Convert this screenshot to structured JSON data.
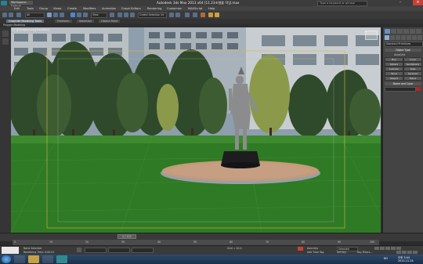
{
  "window": {
    "title": "Autodesk 3ds Max  2013 x64      [11.23조형물 작업.max",
    "workspace": "Workspace: Default",
    "search_placeholder": "Type a keyword or phrase"
  },
  "menus": [
    "Edit",
    "Tools",
    "Group",
    "Views",
    "Create",
    "Modifiers",
    "Animation",
    "Graph Editors",
    "Rendering",
    "Customize",
    "MAXScript",
    "Help"
  ],
  "toolbar": {
    "selection_filter": "All",
    "ref_coord": "View",
    "named_selection": "Create Selection Se"
  },
  "ribbon": {
    "tabs": [
      "Graphite Modeling Tools",
      "Freeform",
      "Selection",
      "Object Paint"
    ],
    "sub": "Polygon Modeling"
  },
  "viewport": {
    "label": "[+][Perspective][Realistic]"
  },
  "command_panel": {
    "dropdown": "Standard Primitives",
    "object_type_title": "Object Type",
    "autogrid": "AutoGrid",
    "buttons": [
      "Box",
      "Cone",
      "Sphere",
      "GeoSphere",
      "Cylinder",
      "Tube",
      "Torus",
      "Pyramid",
      "Teapot",
      "Plane"
    ],
    "name_color_title": "Name and Color"
  },
  "timeline": {
    "slider": "0 / 100",
    "ticks": [
      "0",
      "10",
      "20",
      "30",
      "40",
      "50",
      "60",
      "70",
      "80",
      "90",
      "100"
    ]
  },
  "status": {
    "left1": "None Selected",
    "left2": "Rendering Time: 0:00:01",
    "grid": "Grid = 10.0",
    "autokey": "Auto Key",
    "selected": "Selected",
    "setkey": "Set Key",
    "keyfilters": "Key Filters...",
    "add_time_tag": "Add Time Tag"
  },
  "taskbar": {
    "lang": "KO",
    "time": "오후 3:44",
    "date": "2012-11-24"
  }
}
